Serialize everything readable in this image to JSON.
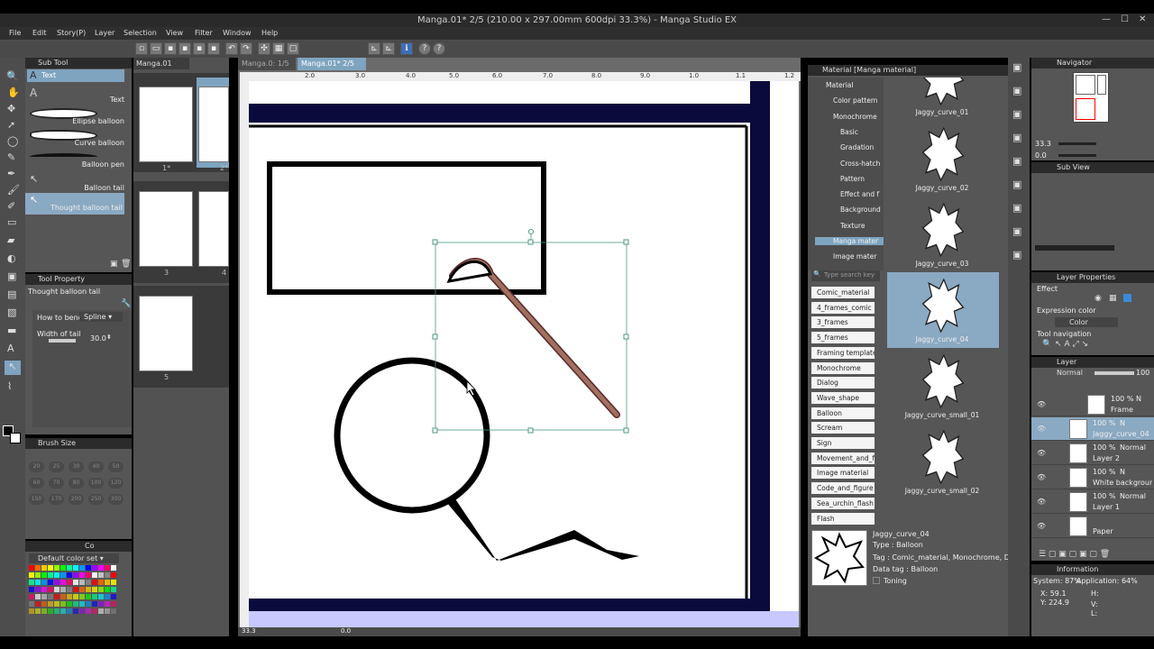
{
  "window": {
    "title": "Manga.01* 2/5 (210.00 x 297.00mm 600dpi 33.3%) - Manga Studio EX"
  },
  "menu": [
    "File",
    "Edit",
    "Story(P)",
    "Layer",
    "Selection",
    "View",
    "Filter",
    "Window",
    "Help"
  ],
  "tabs": {
    "doc_left": "Manga.01",
    "doc_mid": "Manga.0: 1/5",
    "doc_active": "Manga.01* 2/5"
  },
  "subtool": {
    "title": "Sub Tool",
    "tab": "Text",
    "items": [
      "Text",
      "Ellipse balloon",
      "Curve balloon",
      "Balloon pen",
      "Balloon tail",
      "Thought balloon tail"
    ]
  },
  "toolprop": {
    "title": "Tool Property",
    "name": "Thought balloon tail",
    "bend_label": "How to bend",
    "bend_value": "Spline",
    "width_label": "Width of tail",
    "width_value": "30.0"
  },
  "brushsize": {
    "title": "Brush Size",
    "values": [
      "20",
      "25",
      "30",
      "40",
      "50",
      "60",
      "70",
      "80",
      "100",
      "120",
      "150",
      "170",
      "200",
      "250",
      "300"
    ]
  },
  "colorset": {
    "tab": "Co",
    "name": "Default color set"
  },
  "pages": {
    "labels": [
      "1*",
      "2*",
      "3",
      "4",
      "5"
    ]
  },
  "ruler": {
    "ticks": [
      "2.0",
      "3.0",
      "4.0",
      "5.0",
      "6.0",
      "7.0",
      "8.0",
      "9.0",
      "1.0",
      "1.1",
      "1.2"
    ]
  },
  "statusbar": {
    "zoom": "33.3",
    "angle": "0.0"
  },
  "material": {
    "title": "Material [Manga material]",
    "tree": [
      "Material",
      "Color pattern",
      "Monochrome",
      "Basic",
      "Gradation",
      "Cross-hatch",
      "Pattern",
      "Effect and f",
      "Background",
      "Texture",
      "Manga mater",
      "Image mater"
    ],
    "search_placeholder": "Type search key",
    "tags": [
      "Comic_material",
      "4_frames_comic",
      "3_frames",
      "5_frames",
      "Framing template",
      "Monochrome",
      "Dialog",
      "Wave_shape",
      "Balloon",
      "Scream",
      "Sign",
      "Movement_and_fe",
      "Image material",
      "Code_and_figure",
      "Sea_urchin_flash",
      "Flash"
    ],
    "items": [
      "Jaggy_curve_01",
      "Jaggy_curve_02",
      "Jaggy_curve_03",
      "Jaggy_curve_04",
      "Jaggy_curve_small_01",
      "Jaggy_curve_small_02"
    ],
    "detail": {
      "name": "Jaggy_curve_04",
      "type": "Type : Balloon",
      "tag": "Tag : Comic_material, Monochrome, Dialog",
      "datatag": "Data tag : Balloon",
      "toning": "Toning"
    }
  },
  "navigator": {
    "title": "Navigator",
    "zoom": "33.3",
    "angle": "0.0"
  },
  "subview": {
    "title": "Sub View"
  },
  "layerprop": {
    "title": "Layer Properties",
    "effect": "Effect",
    "expr_label": "Expression color",
    "expr_value": "Color",
    "toolnav": "Tool navigation"
  },
  "layers": {
    "title": "Layer",
    "blend": "Normal",
    "opacity": "100",
    "rows": [
      {
        "pct": "100 %",
        "mode": "N",
        "name": "Frame"
      },
      {
        "pct": "100 %",
        "mode": "N",
        "name": "Jaggy_curve_04"
      },
      {
        "pct": "100 %",
        "mode": "Normal",
        "name": "Layer 2"
      },
      {
        "pct": "100 %",
        "mode": "N",
        "name": "White background"
      },
      {
        "pct": "100 %",
        "mode": "Normal",
        "name": "Layer 1"
      },
      {
        "pct": "",
        "mode": "",
        "name": "Paper"
      }
    ]
  },
  "info": {
    "title": "Information",
    "system": "System: 87%",
    "app": "Application: 64%",
    "x": "X: 59.1",
    "y": "Y: 224.9",
    "h": "H:",
    "v": "V:",
    "l": "L:"
  },
  "colors": {
    "accent": "#7ea4c0",
    "navy": "#0a0a3c",
    "bg": "#565656",
    "selected": "#8aa9c2",
    "lavender": "#c8c8ff"
  }
}
